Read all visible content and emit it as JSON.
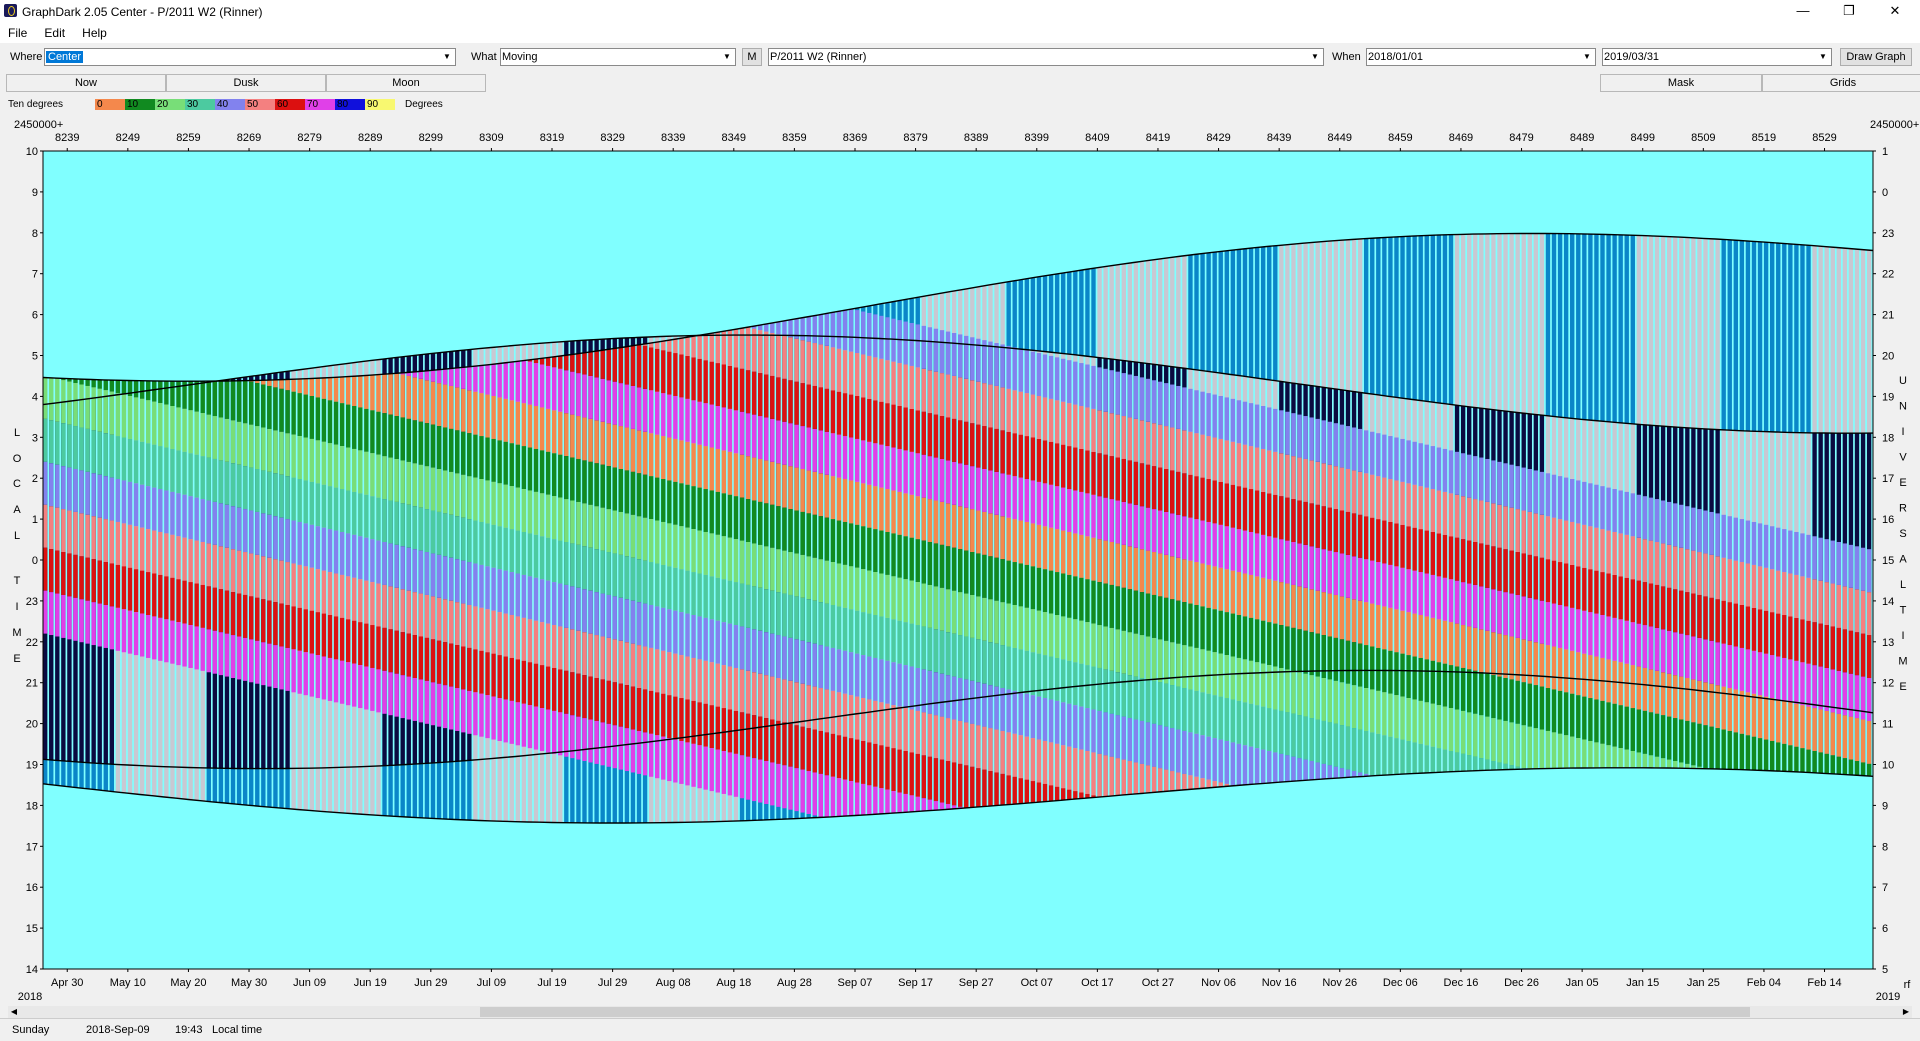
{
  "window": {
    "title": "GraphDark 2.05  Center  -  P/2011 W2 (Rinner)",
    "minimize_icon": "minimize-icon",
    "maximize_icon": "restore-icon",
    "close_icon": "close-icon"
  },
  "menu": [
    "File",
    "Edit",
    "Help"
  ],
  "toolbar": {
    "where_label": "Where",
    "where_value": "Center",
    "what_label": "What",
    "what_value": "Moving",
    "m_button": "M",
    "object_value": "P/2011 W2 (Rinner)",
    "when_label": "When",
    "start_date": "2018/01/01",
    "end_date": "2019/03/31",
    "draw_button": "Draw Graph"
  },
  "tabs": {
    "now": "Now",
    "dusk": "Dusk",
    "moon": "Moon",
    "mask": "Mask",
    "grids": "Grids"
  },
  "legend": {
    "label": "Ten degrees",
    "suffix": "Degrees",
    "ticks": [
      "0",
      "10",
      "20",
      "30",
      "40",
      "50",
      "60",
      "70",
      "80",
      "90"
    ],
    "colors": [
      "#f4884c",
      "#118a20",
      "#78de78",
      "#4ccaa0",
      "#8282ee",
      "#f48080",
      "#dc1010",
      "#e040e8",
      "#1010dc",
      "#f8f870"
    ]
  },
  "colors": {
    "background": "#80ffff",
    "night": "#0a0a40",
    "twilight": "#0a86c8",
    "moon_bars": "#c8c8d2",
    "border_lines": "#000000"
  },
  "chart_data": {
    "type": "heatmap",
    "jd_prefix_left": "2450000+",
    "jd_prefix_right": "2450000+",
    "jd_ticks": [
      "8239",
      "8249",
      "8259",
      "8269",
      "8279",
      "8289",
      "8299",
      "8309",
      "8319",
      "8329",
      "8339",
      "8349",
      "8359",
      "8369",
      "8379",
      "8389",
      "8399",
      "8409",
      "8419",
      "8429",
      "8439",
      "8449",
      "8459",
      "8469",
      "8479",
      "8489",
      "8499",
      "8509",
      "8519",
      "8529"
    ],
    "date_ticks": [
      "Apr 30",
      "May 10",
      "May 20",
      "May 30",
      "Jun 09",
      "Jun 19",
      "Jun 29",
      "Jul 09",
      "Jul 19",
      "Jul 29",
      "Aug 08",
      "Aug 18",
      "Aug 28",
      "Sep 07",
      "Sep 17",
      "Sep 27",
      "Oct 07",
      "Oct 17",
      "Oct 27",
      "Nov 06",
      "Nov 16",
      "Nov 26",
      "Dec 06",
      "Dec 16",
      "Dec 26",
      "Jan 05",
      "Jan 15",
      "Jan 25",
      "Feb 04",
      "Feb 14"
    ],
    "year_left": "2018",
    "year_right": "2019",
    "corner_right": "rf",
    "left_axis_ticks": [
      "10",
      "9",
      "8",
      "7",
      "6",
      "5",
      "4",
      "3",
      "2",
      "1",
      "0",
      "23",
      "22",
      "21",
      "20",
      "19",
      "18",
      "17",
      "16",
      "15",
      "14"
    ],
    "right_axis_ticks": [
      "1",
      "0",
      "23",
      "22",
      "21",
      "20",
      "19",
      "18",
      "17",
      "16",
      "15",
      "14",
      "13",
      "12",
      "11",
      "10",
      "9",
      "8",
      "7",
      "6",
      "5"
    ],
    "left_axis_label": "LOCAL TIME",
    "right_axis_label": "UNIVERSAL TIME",
    "x_range_jd": [
      8235,
      8537
    ],
    "y_range_hours": [
      14,
      34
    ],
    "bands": [
      {
        "name": "moon-low",
        "kind": "moon"
      },
      {
        "name": "orange-band",
        "color_index": 0
      },
      {
        "name": "green-band",
        "color_index": 1
      },
      {
        "name": "light-green-band",
        "color_index": 2
      },
      {
        "name": "blue-band",
        "color_index": 4
      },
      {
        "name": "red-band",
        "color_index": 6
      },
      {
        "name": "magenta-band",
        "color_index": 7
      }
    ]
  },
  "status": {
    "day": "Sunday",
    "date": "2018-Sep-09",
    "time": "19:43",
    "zone": "Local time"
  }
}
